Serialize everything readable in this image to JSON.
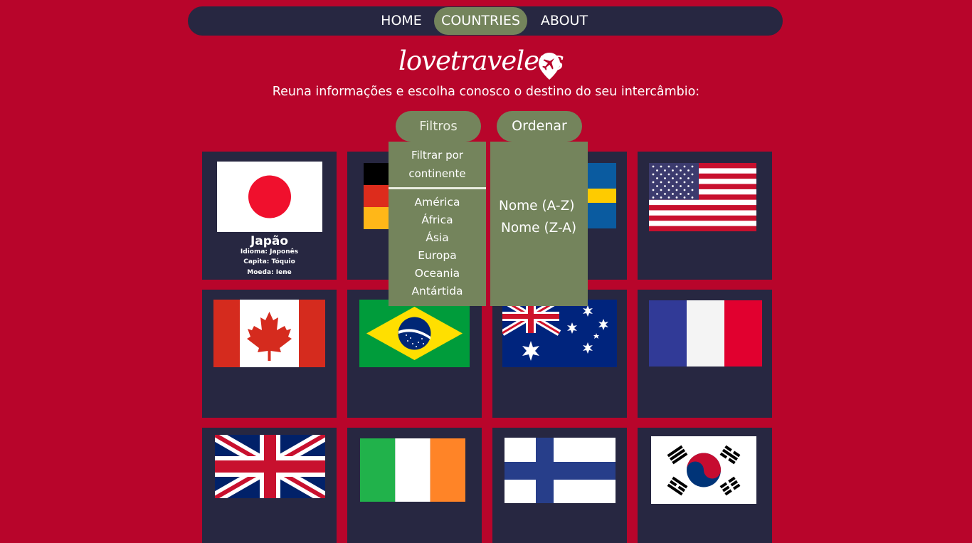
{
  "nav": {
    "items": [
      {
        "label": "HOME"
      },
      {
        "label": "COUNTRIES",
        "active": true
      },
      {
        "label": "ABOUT"
      }
    ]
  },
  "brand": {
    "logo_text": "lovetravelers",
    "tagline": "Reuna informações e escolha conosco o destino do seu intercâmbio:"
  },
  "controls": {
    "filter_label": "Filtros",
    "sort_label": "Ordenar"
  },
  "filter_menu": {
    "heading_line1": "Filtrar por",
    "heading_line2": "continente",
    "options": [
      "América",
      "África",
      "Ásia",
      "Europa",
      "Oceania",
      "Antártida"
    ]
  },
  "sort_menu": {
    "options": [
      "Nome (A-Z)",
      "Nome (Z-A)"
    ]
  },
  "countries": {
    "japan": {
      "name": "Japão",
      "language": "Idioma: Japonês",
      "capital": "Capita: Tóquio",
      "currency": "Moeda: Iene"
    }
  },
  "colors": {
    "background": "#b8052b",
    "navy": "#272741",
    "accent_green": "#74845c"
  }
}
